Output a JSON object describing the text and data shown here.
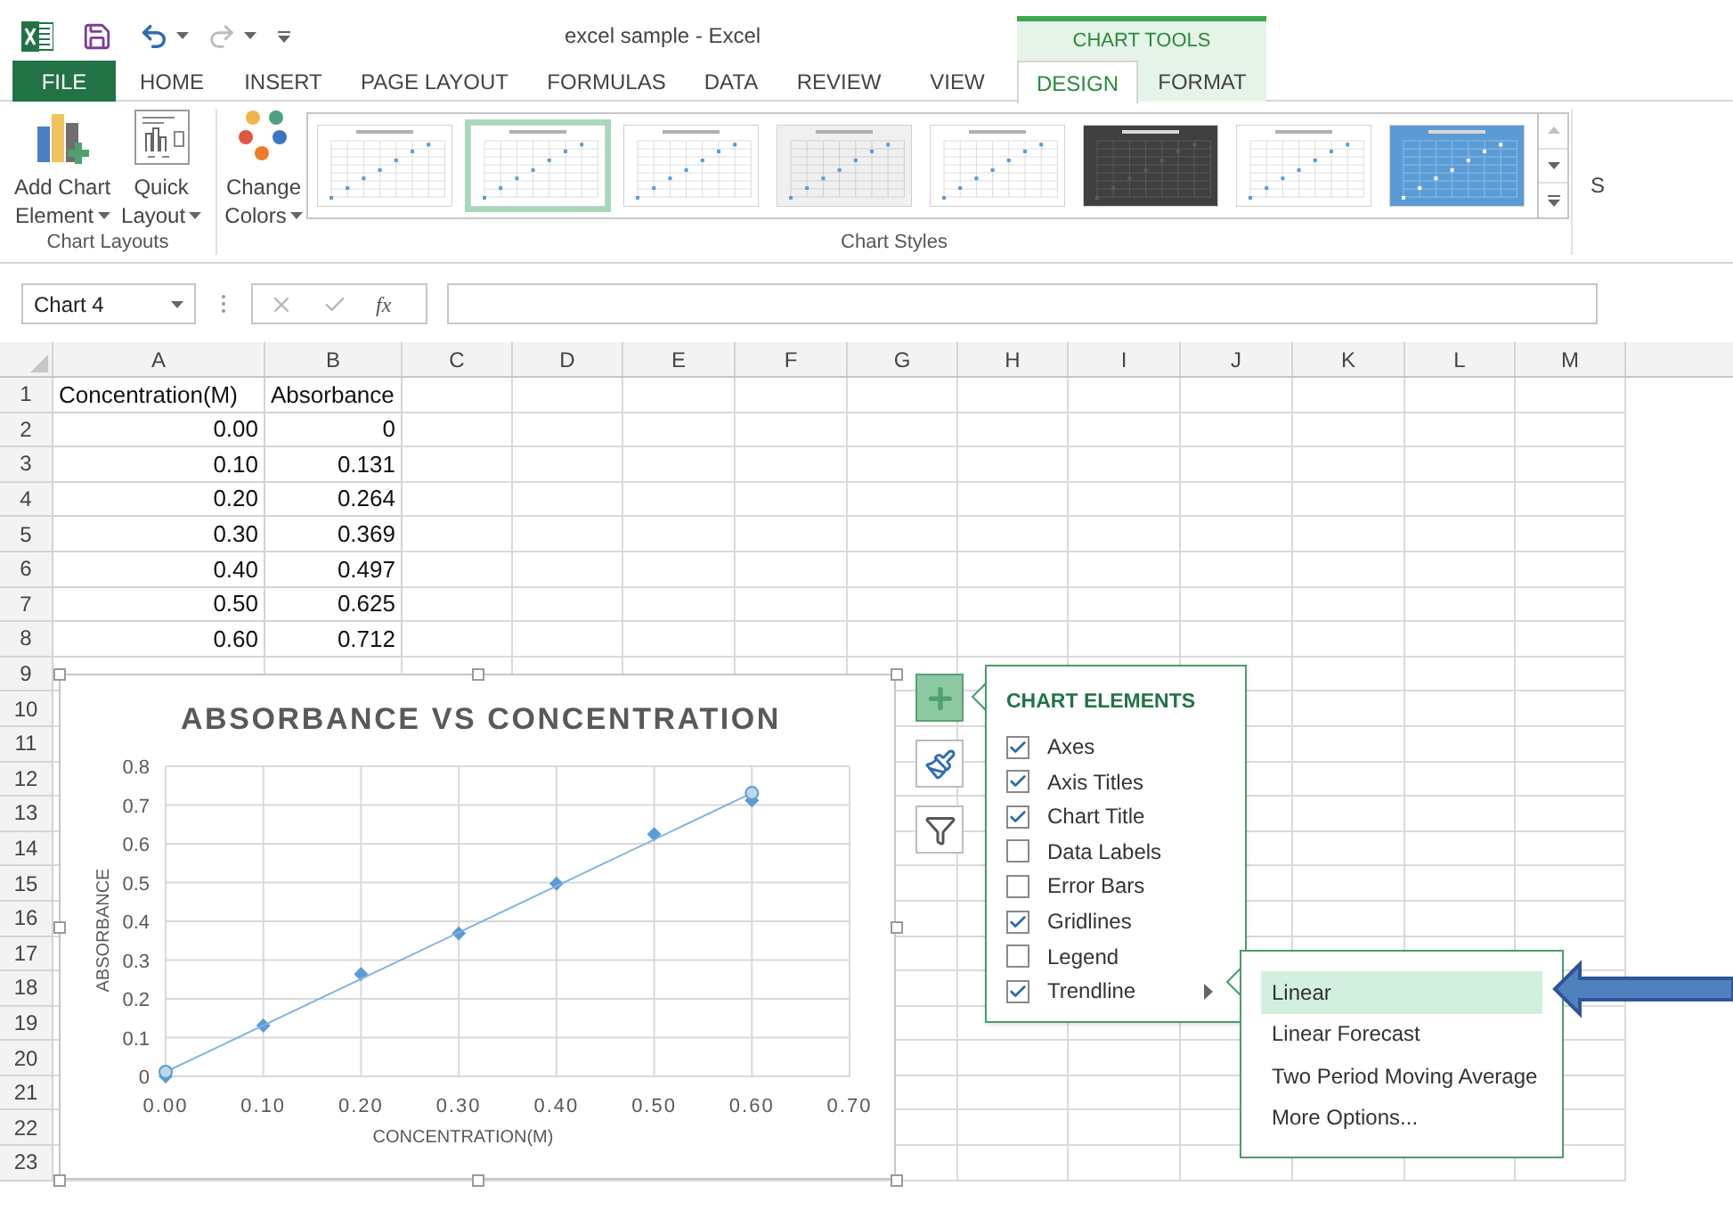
{
  "title_bar": {
    "title": "excel sample - Excel",
    "contextual_group": "CHART TOOLS"
  },
  "tabs": [
    {
      "label": "FILE",
      "kind": "file",
      "selected": false
    },
    {
      "label": "HOME",
      "kind": "normal",
      "selected": false
    },
    {
      "label": "INSERT",
      "kind": "normal",
      "selected": false
    },
    {
      "label": "PAGE LAYOUT",
      "kind": "normal",
      "selected": false
    },
    {
      "label": "FORMULAS",
      "kind": "normal",
      "selected": false
    },
    {
      "label": "DATA",
      "kind": "normal",
      "selected": false
    },
    {
      "label": "REVIEW",
      "kind": "normal",
      "selected": false
    },
    {
      "label": "VIEW",
      "kind": "normal",
      "selected": false
    },
    {
      "label": "DESIGN",
      "kind": "contextual",
      "selected": true
    },
    {
      "label": "FORMAT",
      "kind": "contextual",
      "selected": false
    }
  ],
  "ribbon": {
    "layout_buttons": [
      {
        "kind": "add-element",
        "line1": "Add Chart",
        "line2": "Element"
      },
      {
        "kind": "quick-layout",
        "line1": "Quick",
        "line2": "Layout"
      }
    ],
    "layouts_group": "Chart Layouts",
    "colors_button": {
      "line1": "Change",
      "line2": "Colors"
    },
    "chart_styles": [
      {
        "kind": "light",
        "selected": false
      },
      {
        "kind": "light",
        "selected": true
      },
      {
        "kind": "light",
        "selected": false
      },
      {
        "kind": "shaded",
        "selected": false
      },
      {
        "kind": "light",
        "selected": false
      },
      {
        "kind": "dark",
        "selected": false
      },
      {
        "kind": "light",
        "selected": false
      },
      {
        "kind": "blue",
        "selected": false
      }
    ],
    "styles_group": "Chart Styles",
    "cut_label": "S"
  },
  "formula_bar": {
    "name_box": "Chart 4",
    "function_button": "fx"
  },
  "sheet": {
    "columns": [
      "A",
      "B",
      "C",
      "D",
      "E",
      "F",
      "G",
      "H",
      "I",
      "J",
      "K",
      "L",
      "M"
    ],
    "rows": [
      {
        "label": "1",
        "kind": "text",
        "cells": [
          "Concentration(M)",
          "Absorbance"
        ]
      },
      {
        "label": "2",
        "kind": "number",
        "cells": [
          "0.00",
          "0"
        ]
      },
      {
        "label": "3",
        "kind": "number",
        "cells": [
          "0.10",
          "0.131"
        ]
      },
      {
        "label": "4",
        "kind": "number",
        "cells": [
          "0.20",
          "0.264"
        ]
      },
      {
        "label": "5",
        "kind": "number",
        "cells": [
          "0.30",
          "0.369"
        ]
      },
      {
        "label": "6",
        "kind": "number",
        "cells": [
          "0.40",
          "0.497"
        ]
      },
      {
        "label": "7",
        "kind": "number",
        "cells": [
          "0.50",
          "0.625"
        ]
      },
      {
        "label": "8",
        "kind": "number",
        "cells": [
          "0.60",
          "0.712"
        ]
      },
      {
        "label": "9"
      },
      {
        "label": "10"
      },
      {
        "label": "11"
      },
      {
        "label": "12"
      },
      {
        "label": "13"
      },
      {
        "label": "14"
      },
      {
        "label": "15"
      },
      {
        "label": "16"
      },
      {
        "label": "17"
      },
      {
        "label": "18"
      },
      {
        "label": "19"
      },
      {
        "label": "20"
      },
      {
        "label": "21"
      },
      {
        "label": "22"
      },
      {
        "label": "23"
      }
    ]
  },
  "chart": {
    "chart_data": {
      "type": "scatter",
      "title": "ABSORBANCE VS CONCENTRATION",
      "xlabel": "CONCENTRATION(M)",
      "ylabel": "ABSORBANCE",
      "x": [
        0,
        0.1,
        0.2,
        0.3,
        0.4,
        0.5,
        0.6
      ],
      "series": [
        {
          "color": "#5b9bd5",
          "values": [
            0,
            0.131,
            0.264,
            0.369,
            0.497,
            0.625,
            0.712
          ]
        }
      ],
      "grid": true,
      "xlim": [
        0,
        0.7
      ],
      "ylim": [
        0,
        0.8
      ],
      "xticks": [
        {
          "value": 0,
          "label": "0.00"
        },
        {
          "value": 0.1,
          "label": "0.10"
        },
        {
          "value": 0.2,
          "label": "0.20"
        },
        {
          "value": 0.3,
          "label": "0.30"
        },
        {
          "value": 0.4,
          "label": "0.40"
        },
        {
          "value": 0.5,
          "label": "0.50"
        },
        {
          "value": 0.6,
          "label": "0.60"
        },
        {
          "value": 0.7,
          "label": "0.70"
        }
      ],
      "yticks": [
        0,
        0.1,
        0.2,
        0.3,
        0.4,
        0.5,
        0.6,
        0.7,
        0.8
      ]
    }
  },
  "chart_buttons": [
    {
      "kind": "plus",
      "selected": true
    },
    {
      "kind": "brush",
      "selected": false
    },
    {
      "kind": "filter",
      "selected": false
    }
  ],
  "chart_elements": {
    "title": "CHART ELEMENTS",
    "items": [
      {
        "label": "Axes",
        "checked": true,
        "expanded": false
      },
      {
        "label": "Axis Titles",
        "checked": true,
        "expanded": false
      },
      {
        "label": "Chart Title",
        "checked": true,
        "expanded": false
      },
      {
        "label": "Data Labels",
        "checked": false,
        "expanded": false
      },
      {
        "label": "Error Bars",
        "checked": false,
        "expanded": false
      },
      {
        "label": "Gridlines",
        "checked": true,
        "expanded": false
      },
      {
        "label": "Legend",
        "checked": false,
        "expanded": false
      },
      {
        "label": "Trendline",
        "checked": true,
        "expanded": true
      }
    ]
  },
  "trendline_menu": [
    {
      "label": "Linear",
      "selected": true
    },
    {
      "label": "Linear Forecast",
      "selected": false
    },
    {
      "label": "Two Period Moving Average",
      "selected": false
    },
    {
      "label": "More Options...",
      "selected": false
    }
  ]
}
